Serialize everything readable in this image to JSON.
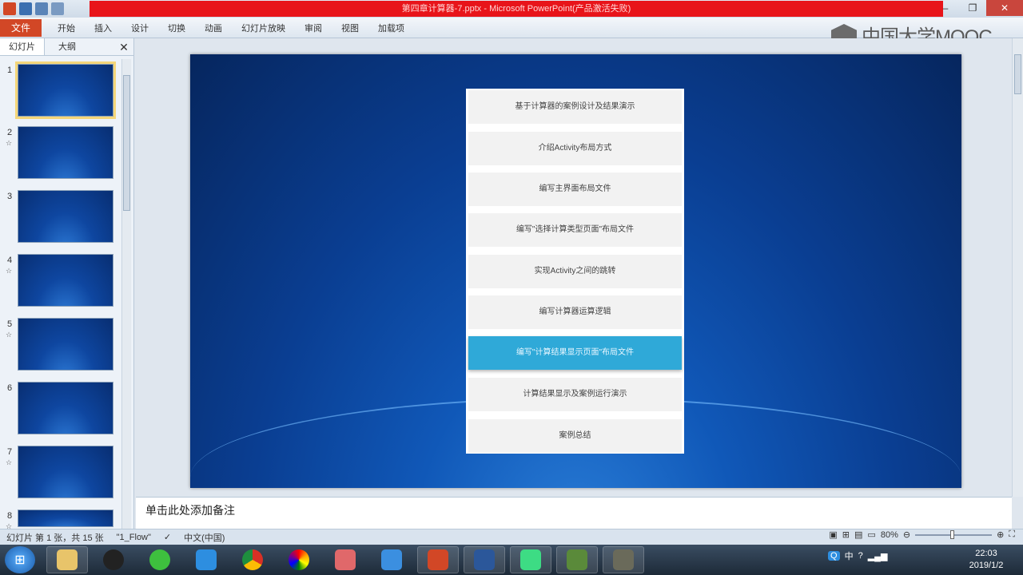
{
  "window": {
    "title": "第四章计算器-7.pptx - Microsoft PowerPoint(产品激活失败)"
  },
  "ribbon": {
    "file_tab": "文件",
    "tabs": [
      "开始",
      "插入",
      "设计",
      "切换",
      "动画",
      "幻灯片放映",
      "审阅",
      "视图",
      "加载项"
    ]
  },
  "watermark": {
    "text": "中国大学MOOC"
  },
  "panel": {
    "tab_slides": "幻灯片",
    "tab_outline": "大纲",
    "close": "✕"
  },
  "thumbnails": [
    {
      "num": "1",
      "star": ""
    },
    {
      "num": "2",
      "star": "☆"
    },
    {
      "num": "3",
      "star": ""
    },
    {
      "num": "4",
      "star": "☆"
    },
    {
      "num": "5",
      "star": "☆"
    },
    {
      "num": "6",
      "star": ""
    },
    {
      "num": "7",
      "star": "☆"
    },
    {
      "num": "8",
      "star": "☆"
    }
  ],
  "slide": {
    "menu_items": [
      "基于计算器的案例设计及结果演示",
      "介绍Activity布局方式",
      "编写主界面布局文件",
      "编写\"选择计算类型页面\"布局文件",
      "实现Activity之间的跳转",
      "编写计算器运算逻辑",
      "编写\"计算结果显示页面\"布局文件",
      "计算结果显示及案例运行演示",
      "案例总结"
    ],
    "highlighted_index": 6
  },
  "notes": {
    "placeholder": "单击此处添加备注"
  },
  "status": {
    "slide_info": "幻灯片 第 1 张，共 15 张",
    "theme": "\"1_Flow\"",
    "language": "中文(中国)",
    "zoom": "80%",
    "zoom_level": 0.8
  },
  "taskbar": {
    "ime": "中",
    "time": "22:03",
    "date": "2019/1/2"
  }
}
